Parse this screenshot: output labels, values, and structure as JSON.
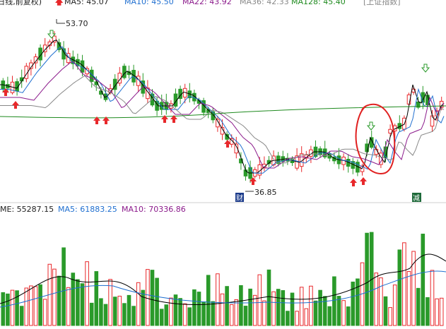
{
  "header": {
    "period_label": "(日线,前复权)",
    "ma5": "MA5: 45.07",
    "ma10": "MA10: 45.50",
    "ma22": "MA22: 43.92",
    "ma36": "MA36: 42.33",
    "ma128": "MA128: 45.40",
    "index_label": "[上证指数]"
  },
  "volume_header": {
    "vol_label": "ME: 55287.15",
    "ma5": "MA5: 61883.25",
    "ma10": "MA10: 70336.86"
  },
  "annotations": {
    "high_label": "53.70",
    "low_label": "36.85",
    "finance_badge": "财",
    "reduce_badge": "减"
  },
  "colors": {
    "up": "#e8282b",
    "down": "#2a9a2a",
    "ma5": "#000000",
    "ma10": "#1f6fd0",
    "ma22": "#8b1a8b",
    "ma36": "#888888",
    "ma128": "#1e8a1e",
    "badge_blue": "#1a3a8a",
    "badge_green": "#1e6a3a",
    "circle": "#e02020"
  }
}
